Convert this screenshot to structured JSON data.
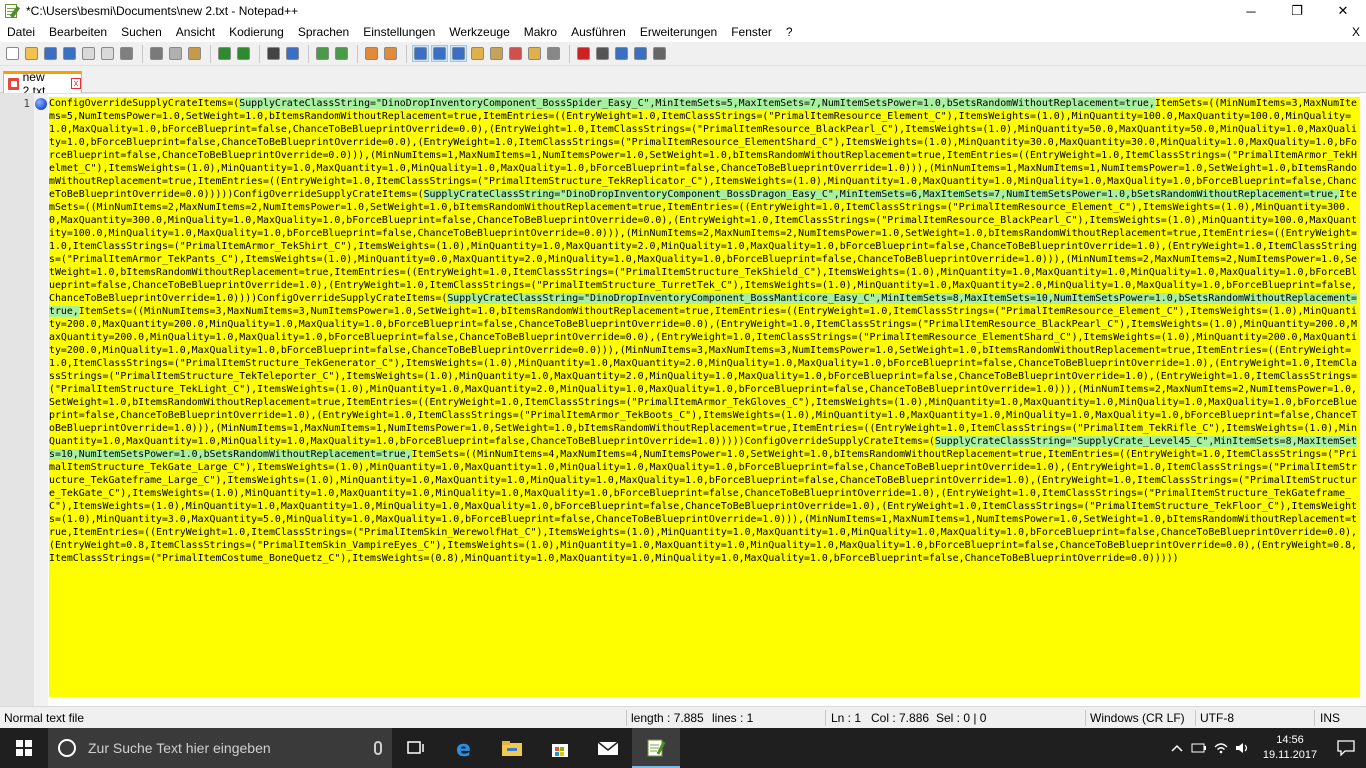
{
  "window": {
    "title": "*C:\\Users\\besmi\\Documents\\new 2.txt - Notepad++",
    "minimize": "─",
    "maximize": "❐",
    "close": "✕"
  },
  "menu": {
    "items": [
      "Datei",
      "Bearbeiten",
      "Suchen",
      "Ansicht",
      "Kodierung",
      "Sprachen",
      "Einstellungen",
      "Werkzeuge",
      "Makro",
      "Ausführen",
      "Erweiterungen",
      "Fenster",
      "?"
    ],
    "close_doc": "X"
  },
  "toolbar": {
    "buttons": [
      {
        "icon": "new-file-icon",
        "color": "#ffffff"
      },
      {
        "icon": "open-file-icon",
        "color": "#f2c14e"
      },
      {
        "icon": "save-icon",
        "color": "#3b6fc4"
      },
      {
        "icon": "save-all-icon",
        "color": "#3b6fc4"
      },
      {
        "icon": "close-icon",
        "color": "#d9d9d9"
      },
      {
        "icon": "close-all-icon",
        "color": "#d9d9d9"
      },
      {
        "icon": "print-icon",
        "color": "#808080"
      },
      {
        "icon": "cut-icon",
        "color": "#7a7a7a"
      },
      {
        "icon": "copy-icon",
        "color": "#b0b0b0"
      },
      {
        "icon": "paste-icon",
        "color": "#c59a4a"
      },
      {
        "icon": "undo-icon",
        "color": "#2f8a2f"
      },
      {
        "icon": "redo-icon",
        "color": "#2f8a2f"
      },
      {
        "icon": "find-icon",
        "color": "#444444"
      },
      {
        "icon": "replace-icon",
        "color": "#3b6fc4"
      },
      {
        "icon": "zoom-in-icon",
        "color": "#4a9a4a"
      },
      {
        "icon": "zoom-out-icon",
        "color": "#4a9a4a"
      },
      {
        "icon": "sync-vertical-icon",
        "color": "#e08a3a"
      },
      {
        "icon": "sync-horizontal-icon",
        "color": "#e08a3a"
      },
      {
        "icon": "word-wrap-icon",
        "color": "#3b6fc4"
      },
      {
        "icon": "show-all-chars-icon",
        "color": "#3b6fc4"
      },
      {
        "icon": "indent-guide-icon",
        "color": "#3b6fc4"
      },
      {
        "icon": "udl-icon",
        "color": "#e0b04a"
      },
      {
        "icon": "doc-map-icon",
        "color": "#c9a25a"
      },
      {
        "icon": "function-list-icon",
        "color": "#d05050"
      },
      {
        "icon": "folder-workspace-icon",
        "color": "#e0b04a"
      },
      {
        "icon": "monitoring-icon",
        "color": "#888888"
      },
      {
        "icon": "record-macro-icon",
        "color": "#cc2222"
      },
      {
        "icon": "stop-record-icon",
        "color": "#555555"
      },
      {
        "icon": "play-macro-icon",
        "color": "#3b6fc4"
      },
      {
        "icon": "run-macro-multiple-icon",
        "color": "#3b6fc4"
      },
      {
        "icon": "save-macro-icon",
        "color": "#666666"
      }
    ]
  },
  "tab": {
    "label": "new 2.txt",
    "close": "x"
  },
  "editor": {
    "line_number": "1",
    "segments": [
      {
        "t": "ConfigOverrideSupplyCrateItems=(",
        "h": false
      },
      {
        "t": "SupplyCrateClassString=\"DinoDropInventoryComponent_BossSpider_Easy_C\",MinItemSets=5,MaxItemSets=7,NumItemSetsPower=1.0,bSetsRandomWithoutReplacement=true,",
        "h": true
      },
      {
        "t": "ItemSets=((MinNumItems=3,MaxNumItems=5,NumItemsPower=1.0,SetWeight=1.0,bItemsRandomWithoutReplacement=true,ItemEntries=((EntryWeight=1.0,ItemClassStrings=(\"PrimalItemResource_Element_C\"),ItemsWeights=(1.0),MinQuantity=100.0,MaxQuantity=100.0,MinQuality=1.0,MaxQuality=1.0,bForceBlueprint=false,ChanceToBeBlueprintOverride=0.0),(EntryWeight=1.0,ItemClassStrings=(\"PrimalItemResource_BlackPearl_C\"),ItemsWeights=(1.0),MinQuantity=50.0,MaxQuantity=50.0,MinQuality=1.0,MaxQuality=1.0,bForceBlueprint=false,ChanceToBeBlueprintOverride=0.0),(EntryWeight=1.0,ItemClassStrings=(\"PrimalItemResource_ElementShard_C\"),ItemsWeights=(1.0),MinQuantity=30.0,MaxQuantity=30.0,MinQuality=1.0,MaxQuality=1.0,bForceBlueprint=false,ChanceToBeBlueprintOverride=0.0))),(MinNumItems=1,MaxNumItems=1,NumItemsPower=1.0,SetWeight=1.0,bItemsRandomWithoutReplacement=true,ItemEntries=((EntryWeight=1.0,ItemClassStrings=(\"PrimalItemArmor_TekHelmet_C\"),ItemsWeights=(1.0),MinQuantity=1.0,MaxQuantity=1.0,MinQuality=1.0,MaxQuality=1.0,bForceBlueprint=false,ChanceToBeBlueprintOverride=1.0))),(MinNumItems=1,MaxNumItems=1,NumItemsPower=1.0,SetWeight=1.0,bItemsRandomWithoutReplacement=true,ItemEntries=((EntryWeight=1.0,ItemClassStrings=(\"PrimalItemStructure_TekReplicator_C\"),ItemsWeights=(1.0),MinQuantity=1.0,MaxQuantity=1.0,MinQuality=1.0,MaxQuality=1.0,bForceBlueprint=false,ChanceToBeBlueprintOverride=0.0)))))",
        "h": false
      },
      {
        "t": "ConfigOverrideSupplyCrateItems=(",
        "h": false
      },
      {
        "t": "SupplyCrateClassString=\"DinoDropInventoryComponent_BossDragon_Easy_C\",MinItemSets=6,MaxItemSets=7,NumItemSetsPower=1.0,bSetsRandomWithoutReplacement=true,",
        "h": true
      },
      {
        "t": "ItemSets=((MinNumItems=2,MaxNumItems=2,NumItemsPower=1.0,SetWeight=1.0,bItemsRandomWithoutReplacement=true,ItemEntries=((EntryWeight=1.0,ItemClassStrings=(\"PrimalItemResource_Element_C\"),ItemsWeights=(1.0),MinQuantity=300.0,MaxQuantity=300.0,MinQuality=1.0,MaxQuality=1.0,bForceBlueprint=false,ChanceToBeBlueprintOverride=0.0),(EntryWeight=1.0,ItemClassStrings=(\"PrimalItemResource_BlackPearl_C\"),ItemsWeights=(1.0),MinQuantity=100.0,MaxQuantity=100.0,MinQuality=1.0,MaxQuality=1.0,bForceBlueprint=false,ChanceToBeBlueprintOverride=0.0))),(MinNumItems=2,MaxNumItems=2,NumItemsPower=1.0,SetWeight=1.0,bItemsRandomWithoutReplacement=true,ItemEntries=((EntryWeight=1.0,ItemClassStrings=(\"PrimalItemArmor_TekShirt_C\"),ItemsWeights=(1.0),MinQuantity=1.0,MaxQuantity=2.0,MinQuality=1.0,MaxQuality=1.0,bForceBlueprint=false,ChanceToBeBlueprintOverride=1.0),(EntryWeight=1.0,ItemClassStrings=(\"PrimalItemArmor_TekPants_C\"),ItemsWeights=(1.0),MinQuantity=0.0,MaxQuantity=2.0,MinQuality=1.0,MaxQuality=1.0,bForceBlueprint=false,ChanceToBeBlueprintOverride=1.0))),(MinNumItems=2,MaxNumItems=2,NumItemsPower=1.0,SetWeight=1.0,bItemsRandomWithoutReplacement=true,ItemEntries=((EntryWeight=1.0,ItemClassStrings=(\"PrimalItemStructure_TekShield_C\"),ItemsWeights=(1.0),MinQuantity=1.0,MaxQuantity=1.0,MinQuality=1.0,MaxQuality=1.0,bForceBlueprint=false,ChanceToBeBlueprintOverride=1.0),(EntryWeight=1.0,ItemClassStrings=(\"PrimalItemStructure_TurretTek_C\"),ItemsWeights=(1.0),MinQuantity=1.0,MaxQuantity=2.0,MinQuality=1.0,MaxQuality=1.0,bForceBlueprint=false,ChanceToBeBlueprintOverride=1.0))))",
        "h": false
      },
      {
        "t": "ConfigOverrideSupplyCrateItems=(",
        "h": false
      },
      {
        "t": "SupplyCrateClassString=\"DinoDropInventoryComponent_BossManticore_Easy_C\",MinItemSets=8,MaxItemSets=10,NumItemSetsPower=1.0,bSetsRandomWithoutReplacement=true,",
        "h": true
      },
      {
        "t": "ItemSets=((MinNumItems=3,MaxNumItems=3,NumItemsPower=1.0,SetWeight=1.0,bItemsRandomWithoutReplacement=true,ItemEntries=((EntryWeight=1.0,ItemClassStrings=(\"PrimalItemResource_Element_C\"),ItemsWeights=(1.0),MinQuantity=200.0,MaxQuantity=200.0,MinQuality=1.0,MaxQuality=1.0,bForceBlueprint=false,ChanceToBeBlueprintOverride=0.0),(EntryWeight=1.0,ItemClassStrings=(\"PrimalItemResource_BlackPearl_C\"),ItemsWeights=(1.0),MinQuantity=200.0,MaxQuantity=200.0,MinQuality=1.0,MaxQuality=1.0,bForceBlueprint=false,ChanceToBeBlueprintOverride=0.0),(EntryWeight=1.0,ItemClassStrings=(\"PrimalItemResource_ElementShard_C\"),ItemsWeights=(1.0),MinQuantity=200.0,MaxQuantity=200.0,MinQuality=1.0,MaxQuality=1.0,bForceBlueprint=false,ChanceToBeBlueprintOverride=0.0))),(MinNumItems=3,MaxNumItems=3,NumItemsPower=1.0,SetWeight=1.0,bItemsRandomWithoutReplacement=true,ItemEntries=((EntryWeight=1.0,ItemClassStrings=(\"PrimalItemStructure_TekGenerator_C\"),ItemsWeights=(1.0),MinQuantity=1.0,MaxQuantity=2.0,MinQuality=1.0,MaxQuality=1.0,bForceBlueprint=false,ChanceToBeBlueprintOverride=1.0),(EntryWeight=1.0,ItemClassStrings=(\"PrimalItemStructure_TekTeleporter_C\"),ItemsWeights=(1.0),MinQuantity=1.0,MaxQuantity=2.0,MinQuality=1.0,MaxQuality=1.0,bForceBlueprint=false,ChanceToBeBlueprintOverride=1.0),(EntryWeight=1.0,ItemClassStrings=(\"PrimalItemStructure_TekLight_C\"),ItemsWeights=(1.0),MinQuantity=1.0,MaxQuantity=2.0,MinQuality=1.0,MaxQuality=1.0,bForceBlueprint=false,ChanceToBeBlueprintOverride=1.0))),(MinNumItems=2,MaxNumItems=2,NumItemsPower=1.0,SetWeight=1.0,bItemsRandomWithoutReplacement=true,ItemEntries=((EntryWeight=1.0,ItemClassStrings=(\"PrimalItemArmor_TekGloves_C\"),ItemsWeights=(1.0),MinQuantity=1.0,MaxQuantity=1.0,MinQuality=1.0,MaxQuality=1.0,bForceBlueprint=false,ChanceToBeBlueprintOverride=1.0),(EntryWeight=1.0,ItemClassStrings=(\"PrimalItemArmor_TekBoots_C\"),ItemsWeights=(1.0),MinQuantity=1.0,MaxQuantity=1.0,MinQuality=1.0,MaxQuality=1.0,bForceBlueprint=false,ChanceToBeBlueprintOverride=1.0))),(MinNumItems=1,MaxNumItems=1,NumItemsPower=1.0,SetWeight=1.0,bItemsRandomWithoutReplacement=true,ItemEntries=((EntryWeight=1.0,ItemClassStrings=(\"PrimalItem_TekRifle_C\"),ItemsWeights=(1.0),MinQuantity=1.0,MaxQuantity=1.0,MinQuality=1.0,MaxQuality=1.0,bForceBlueprint=false,ChanceToBeBlueprintOverride=1.0)))))",
        "h": false
      },
      {
        "t": "ConfigOverrideSupplyCrateItems=(",
        "h": false
      },
      {
        "t": "SupplyCrateClassString=\"SupplyCrate_Level45_C\",MinItemSets=8,MaxItemSets=10,NumItemSetsPower=1.0,bSetsRandomWithoutReplacement=true,",
        "h": true
      },
      {
        "t": "ItemSets=((MinNumItems=4,MaxNumItems=4,NumItemsPower=1.0,SetWeight=1.0,bItemsRandomWithoutReplacement=true,ItemEntries=((EntryWeight=1.0,ItemClassStrings=(\"PrimalItemStructure_TekGate_Large_C\"),ItemsWeights=(1.0),MinQuantity=1.0,MaxQuantity=1.0,MinQuality=1.0,MaxQuality=1.0,bForceBlueprint=false,ChanceToBeBlueprintOverride=1.0),(EntryWeight=1.0,ItemClassStrings=(\"PrimalItemStructure_TekGateframe_Large_C\"),ItemsWeights=(1.0),MinQuantity=1.0,MaxQuantity=1.0,MinQuality=1.0,MaxQuality=1.0,bForceBlueprint=false,ChanceToBeBlueprintOverride=1.0),(EntryWeight=1.0,ItemClassStrings=(\"PrimalItemStructure_TekGate_C\"),ItemsWeights=(1.0),MinQuantity=1.0,MaxQuantity=1.0,MinQuality=1.0,MaxQuality=1.0,bForceBlueprint=false,ChanceToBeBlueprintOverride=1.0),(EntryWeight=1.0,ItemClassStrings=(\"PrimalItemStructure_TekGateframe_C\"),ItemsWeights=(1.0),MinQuantity=1.0,MaxQuantity=1.0,MinQuality=1.0,MaxQuality=1.0,bForceBlueprint=false,ChanceToBeBlueprintOverride=1.0),(EntryWeight=1.0,ItemClassStrings=(\"PrimalItemStructure_TekFloor_C\"),ItemsWeights=(1.0),MinQuantity=3.0,MaxQuantity=5.0,MinQuality=1.0,MaxQuality=1.0,bForceBlueprint=false,ChanceToBeBlueprintOverride=1.0))),(MinNumItems=1,MaxNumItems=1,NumItemsPower=1.0,SetWeight=1.0,bItemsRandomWithoutReplacement=true,ItemEntries=((EntryWeight=1.0,ItemClassStrings=(\"PrimalItemSkin_WerewolfHat_C\"),ItemsWeights=(1.0),MinQuantity=1.0,MaxQuantity=1.0,MinQuality=1.0,MaxQuality=1.0,bForceBlueprint=false,ChanceToBeBlueprintOverride=0.0),(EntryWeight=0.8,ItemClassStrings=(\"PrimalItemSkin_VampireEyes_C\"),ItemsWeights=(1.0),MinQuantity=1.0,MaxQuantity=1.0,MinQuality=1.0,MaxQuality=1.0,bForceBlueprint=false,ChanceToBeBlueprintOverride=0.0),(EntryWeight=0.8,ItemClassStrings=(\"PrimalItemCostume_BoneQuetz_C\"),ItemsWeights=(0.8),MinQuantity=1.0,MaxQuantity=1.0,MinQuality=1.0,MaxQuality=1.0,bForceBlueprint=false,ChanceToBeBlueprintOverride=0.0)))))",
        "h": false
      }
    ]
  },
  "status": {
    "file_type": "Normal text file",
    "length": "length : 7.885",
    "lines": "lines : 1",
    "ln": "Ln : 1",
    "col": "Col : 7.886",
    "sel": "Sel : 0 | 0",
    "eol": "Windows (CR LF)",
    "encoding": "UTF-8",
    "mode": "INS"
  },
  "taskbar": {
    "search_placeholder": "Zur Suche Text hier eingeben",
    "time": "14:56",
    "date": "19.11.2017"
  }
}
